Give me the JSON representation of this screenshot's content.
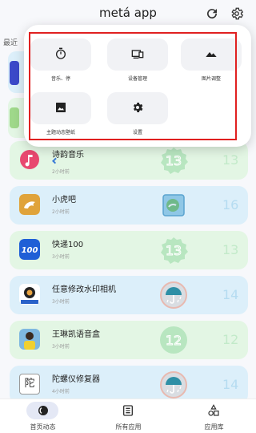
{
  "header": {
    "app_title": "metá app",
    "refresh_icon": "refresh-icon",
    "settings_icon": "gear-icon"
  },
  "section_label": "最近",
  "popup_menu": {
    "items": [
      {
        "label": "音乐、停",
        "icon": "timer-icon"
      },
      {
        "label": "设备管理",
        "icon": "device-manage-icon"
      },
      {
        "label": "图片调整",
        "icon": "mountain-image-icon"
      },
      {
        "label": "主题动态壁纸",
        "icon": "wallpaper-image-icon"
      },
      {
        "label": "设置",
        "icon": "gear-icon"
      }
    ],
    "highlight_color": "#e02020"
  },
  "app_list": [
    {
      "name": "诗韵音乐",
      "time": "2小时前",
      "number": "13",
      "icon": "music-note-icon",
      "bg": "#e3f6e4",
      "accent": "#b8e6c0"
    },
    {
      "name": "小虎吧",
      "time": "2小时前",
      "number": "16",
      "icon": "tiger-icon",
      "bg": "#dceffa",
      "accent": "#a8d6ee"
    },
    {
      "name": "快递100",
      "time": "3小时前",
      "number": "13",
      "icon": "kuaidi100-icon",
      "bg": "#e3f6e4",
      "accent": "#b8e6c0"
    },
    {
      "name": "任意修改水印相机",
      "time": "3小时前",
      "number": "14",
      "icon": "camera-icon",
      "bg": "#dceffa",
      "accent": "#a8d6ee"
    },
    {
      "name": "王琳凯语音盒",
      "time": "3小时前",
      "number": "12",
      "icon": "avatar-icon",
      "bg": "#e3f6e4",
      "accent": "#b8e6c0"
    },
    {
      "name": "陀螺仪修复器",
      "time": "4小时前",
      "number": "14",
      "icon": "gyro-icon",
      "bg": "#dceffa",
      "accent": "#a8d6ee"
    }
  ],
  "bottom_nav": [
    {
      "label": "首页动态",
      "icon": "home-dynamic-icon",
      "active": true
    },
    {
      "label": "所有应用",
      "icon": "list-icon",
      "active": false
    },
    {
      "label": "应用库",
      "icon": "app-library-icon",
      "active": false
    }
  ]
}
